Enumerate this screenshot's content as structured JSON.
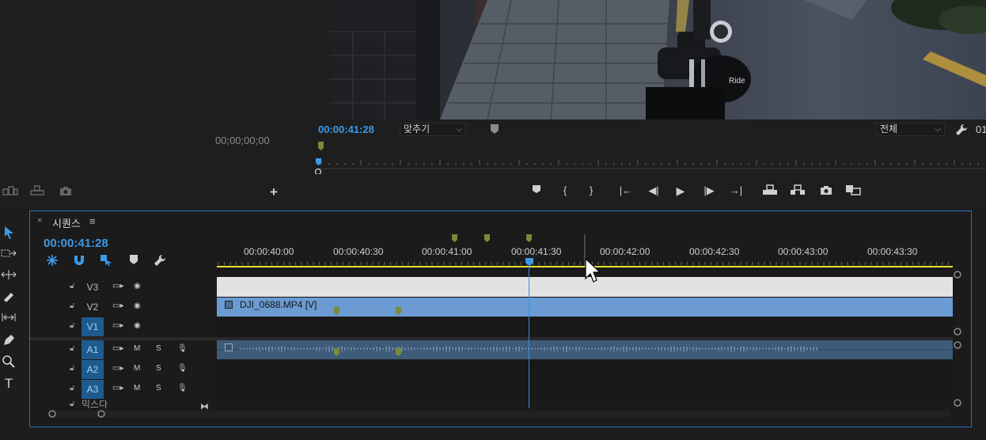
{
  "source_monitor": {
    "timecode": "00;00;00;00",
    "add_label": "+"
  },
  "program_monitor": {
    "timecode": "00:00:41:28",
    "zoom_select": "맞추기",
    "quality_select": "전체",
    "cut_text": "01"
  },
  "timeline": {
    "tab_close": "×",
    "tab_title": "시퀀스",
    "tab_menu": "≡",
    "timecode": "00:00:41:28",
    "ruler_labels": [
      "00:00:40:00",
      "00:00:40:30",
      "00:00:41:00",
      "00:00:41:30",
      "00:00:42:00",
      "00:00:42:30",
      "00:00:43:00",
      "00:00:43:30"
    ],
    "video_tracks": [
      {
        "id": "V3",
        "active": false
      },
      {
        "id": "V2",
        "active": false
      },
      {
        "id": "V1",
        "active": true
      }
    ],
    "audio_tracks": [
      {
        "id": "A1",
        "active": true
      },
      {
        "id": "A2",
        "active": true
      },
      {
        "id": "A3",
        "active": true
      }
    ],
    "clip_name": "DJI_0688.MP4 [V]",
    "mute_label": "M",
    "solo_label": "S",
    "mix_label": "믹스다"
  },
  "colors": {
    "accent": "#3d9ae8",
    "clip_video": "#6b9bd2",
    "clip_audio": "#3f5b7a",
    "work_area": "#e6e236",
    "marker": "#7a8a3a"
  }
}
